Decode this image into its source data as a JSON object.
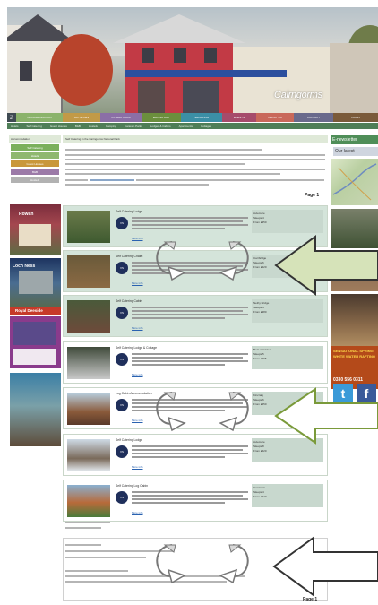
{
  "site": {
    "logo_text": "Cairngorms",
    "nav_home_icon": "logo-mark-icon",
    "nav": [
      {
        "label": "ACCOMMODATION",
        "color": "#8bb36b"
      },
      {
        "label": "ACTIVITIES",
        "color": "#c29a47"
      },
      {
        "label": "ATTRACTIONS",
        "color": "#8b6fa6"
      },
      {
        "label": "EATING OUT",
        "color": "#6b8f3d"
      },
      {
        "label": "SHOPPING",
        "color": "#3b8fa6"
      },
      {
        "label": "EVENTS",
        "color": "#a64b6b"
      },
      {
        "label": "ABOUT US",
        "color": "#c9685a"
      },
      {
        "label": "CONTACT",
        "color": "#6a6a8c"
      },
      {
        "label": "LOGIN",
        "color": "#7a5a3a"
      }
    ],
    "subnav": [
      "Hotels",
      "Self Catering",
      "Guest Houses",
      "B&B",
      "Hostels",
      "Camping",
      "Caravan Parks",
      "Lodges & Cabins",
      "Apartments",
      "Cottages"
    ]
  },
  "left": {
    "header": "Accommodation",
    "buttons": [
      {
        "label": "Self Catering",
        "color": "#7bb05c"
      },
      {
        "label": "Hotels",
        "color": "#8fb86f"
      },
      {
        "label": "Guest Houses",
        "color": "#c9973c"
      },
      {
        "label": "B&B",
        "color": "#9c7aa8"
      },
      {
        "label": "Hostels",
        "color": "#b2b2b2"
      }
    ],
    "ads": [
      {
        "name": "ad-rowan-house",
        "text": "Rowan"
      },
      {
        "name": "ad-loch-ness",
        "text": "Loch Ness"
      },
      {
        "name": "ad-royal-deeside",
        "text": "Royal Deeside"
      },
      {
        "name": "ad-activities",
        "text": ""
      }
    ]
  },
  "main": {
    "breadcrumb": "Self Catering in the Cairngorms National Park",
    "page_label": "Page 1",
    "listings": [
      {
        "title": "Self Catering Lodge",
        "badge": "VS",
        "more": "More info",
        "meta": [
          "Aviemore",
          "Sleeps 4",
          "From £350"
        ],
        "shade": true,
        "thumb": "linear-gradient(180deg,#6b7a4a,#3e5a30)"
      },
      {
        "title": "Self Catering Chalet",
        "badge": "VS",
        "more": "More info",
        "meta": [
          "Carrbridge",
          "Sleeps 6",
          "From £420"
        ],
        "shade": true,
        "thumb": "linear-gradient(180deg,#6a5a3a,#8b6a44)"
      },
      {
        "title": "Self Catering Cabin",
        "badge": "VS",
        "more": "More info",
        "meta": [
          "Nethy Bridge",
          "Sleeps 4",
          "From £380"
        ],
        "shade": true,
        "thumb": "linear-gradient(180deg,#4a5a3a,#6d4a3a)"
      },
      {
        "title": "Self Catering Lodge & Cottage",
        "badge": "VS",
        "more": "More info",
        "meta": [
          "Boat of Garten",
          "Sleeps 5",
          "From £395"
        ],
        "shade": false,
        "thumb": "linear-gradient(180deg,#3f4a3a,#c9c9c9)"
      },
      {
        "title": "Log Cabin Accommodation",
        "badge": "VS",
        "more": "More info",
        "meta": [
          "Kincraig",
          "Sleeps 6",
          "From £450"
        ],
        "shade": false,
        "thumb": "linear-gradient(180deg,#b8d0e0,#8a5a3a 60%,#5a3a2a)"
      },
      {
        "title": "Self Catering Lodge",
        "badge": "VS",
        "more": "More info",
        "meta": [
          "Aviemore",
          "Sleeps 8",
          "From £520"
        ],
        "shade": false,
        "thumb": "linear-gradient(180deg,#cfdbe6,#7a6a5a 60%,#e6ecf2)"
      },
      {
        "title": "Self Catering Log Cabin",
        "badge": "VS",
        "more": "More info",
        "meta": [
          "Grantown",
          "Sleeps 4",
          "From £340"
        ],
        "shade": false,
        "thumb": "linear-gradient(180deg,#8ab0d0,#b86a3a 55%,#4a7a3a)"
      }
    ],
    "bottom_notes": [
      "Cairngorms Self Catering",
      "Other Self Catering",
      "Further Self Catering"
    ]
  },
  "right": {
    "enews_label": "E-newsletter",
    "latest_label": "Our latest",
    "spring_text": "SENSATIONAL SPRING WHITE WATER RAFTING",
    "phone": "0330 556 0311",
    "social": [
      {
        "icon": "twitter-icon",
        "glyph": "t"
      },
      {
        "icon": "facebook-icon",
        "glyph": "f"
      }
    ]
  }
}
